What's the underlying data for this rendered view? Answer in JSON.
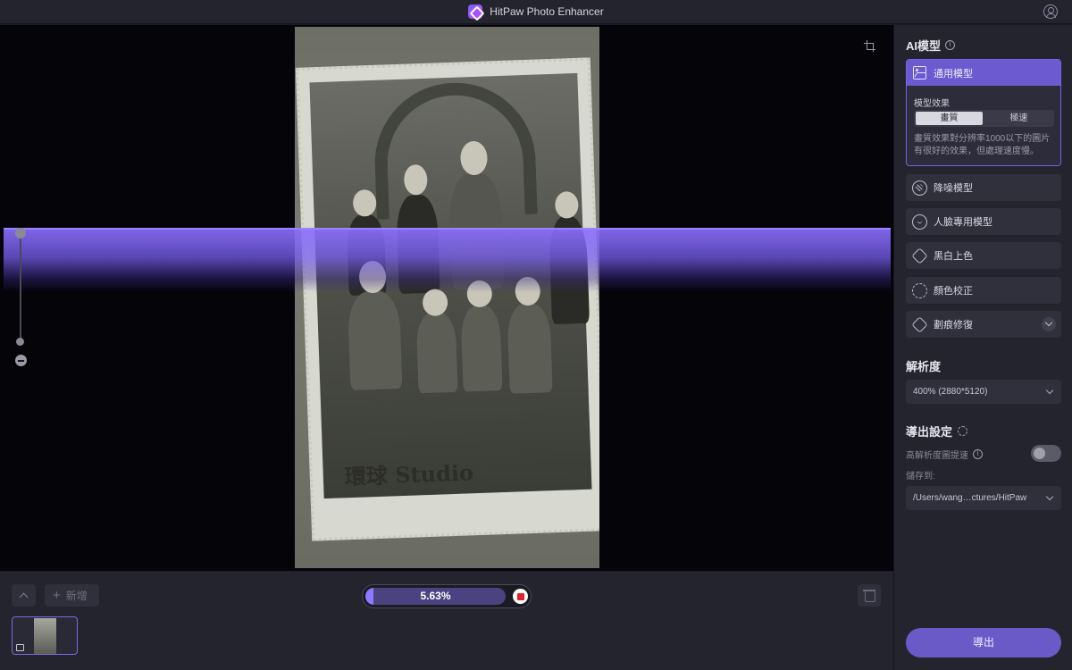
{
  "window": {
    "title": "HitPaw Photo Enhancer"
  },
  "canvas": {
    "photo_watermark": "環球 Studio"
  },
  "bottom_bar": {
    "add_label": "新增",
    "progress_text": "5.63%",
    "progress_fraction": 0.0563
  },
  "panel": {
    "ai_model_title": "AI模型",
    "general_model": {
      "label": "通用模型",
      "effect_label": "模型效果",
      "options": [
        "畫質",
        "極速"
      ],
      "selected": "畫質",
      "description": "畫質效果對分辨率1000以下的圖片有很好的效果，但處理速度慢。"
    },
    "models": [
      {
        "label": "降噪模型",
        "icon": "denoise-icon"
      },
      {
        "label": "人臉專用模型",
        "icon": "face-icon"
      },
      {
        "label": "黑白上色",
        "icon": "colorize-icon"
      },
      {
        "label": "顏色校正",
        "icon": "color-correction-icon"
      },
      {
        "label": "劃痕修復",
        "icon": "scratch-repair-icon"
      }
    ],
    "resolution_title": "解析度",
    "resolution_value": "400% (2880*5120)",
    "export_settings_title": "導出設定",
    "accel_label": "高解析度圖提速",
    "accel_enabled": false,
    "save_to_label": "儲存到:",
    "save_path": "/Users/wang…ctures/HitPaw",
    "export_label": "導出"
  },
  "colors": {
    "accent": "#6c5ad0",
    "scan_band": "#8c6eff",
    "stop": "#e0202e"
  }
}
